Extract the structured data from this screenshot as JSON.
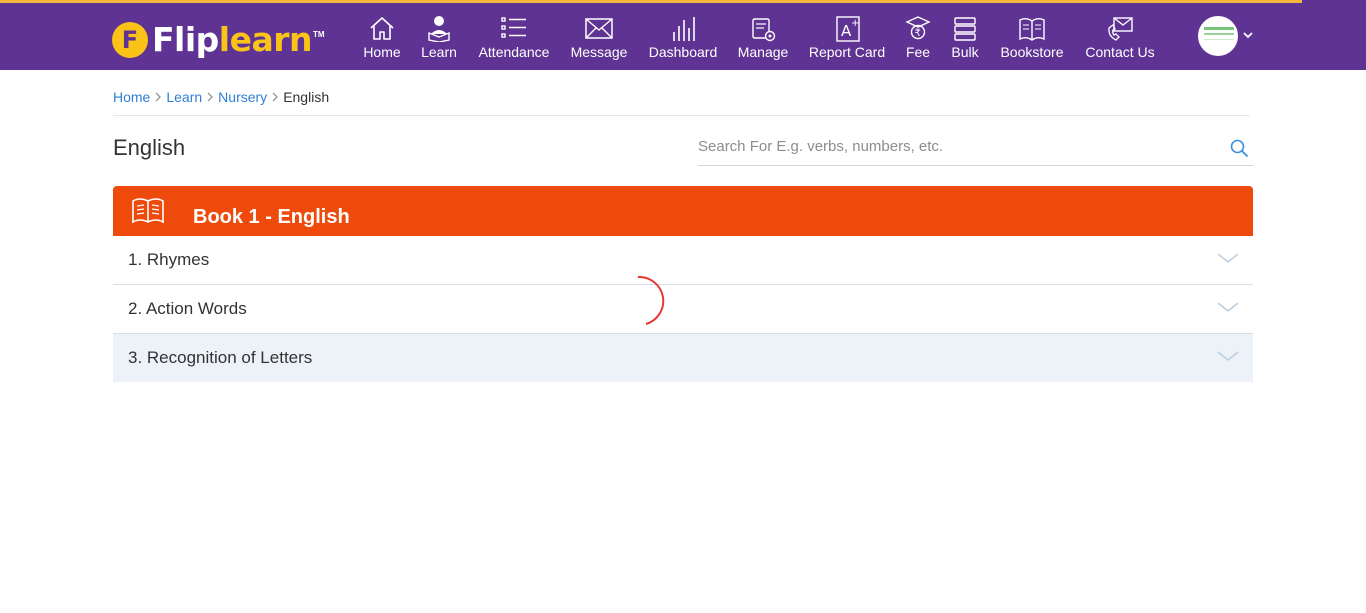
{
  "brand": {
    "logo_letter": "F",
    "logo_text_a": "Flip",
    "logo_text_b": "learn",
    "logo_tm": "TM"
  },
  "colors": {
    "nav_bg": "#5f3393",
    "accent_bar": "#f4b73e",
    "book_header": "#ee4a0b",
    "link": "#2f7fd6"
  },
  "nav": {
    "items": [
      {
        "label": "Home",
        "icon": "home-icon"
      },
      {
        "label": "Learn",
        "icon": "learn-icon"
      },
      {
        "label": "Attendance",
        "icon": "attendance-icon"
      },
      {
        "label": "Message",
        "icon": "message-icon"
      },
      {
        "label": "Dashboard",
        "icon": "dashboard-icon"
      },
      {
        "label": "Manage",
        "icon": "manage-icon"
      },
      {
        "label": "Report Card",
        "icon": "report-card-icon"
      },
      {
        "label": "Fee",
        "icon": "fee-icon"
      },
      {
        "label": "Bulk",
        "icon": "bulk-icon"
      },
      {
        "label": "Bookstore",
        "icon": "bookstore-icon"
      },
      {
        "label": "Contact Us",
        "icon": "contact-icon"
      }
    ]
  },
  "breadcrumb": {
    "items": [
      "Home",
      "Learn",
      "Nursery"
    ],
    "current": "English"
  },
  "page": {
    "title": "English"
  },
  "search": {
    "placeholder": "Search For E.g. verbs, numbers, etc.",
    "value": ""
  },
  "book": {
    "title": "Book 1 - English",
    "chapters": [
      {
        "label": "1. Rhymes"
      },
      {
        "label": "2. Action Words"
      },
      {
        "label": "3. Recognition of Letters"
      }
    ]
  }
}
